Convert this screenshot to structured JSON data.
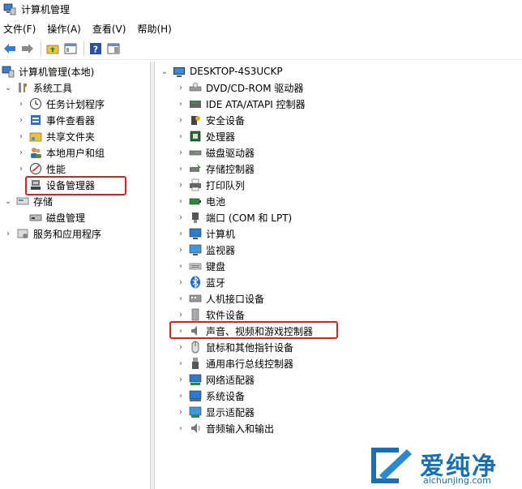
{
  "window": {
    "title": "计算机管理"
  },
  "menu": [
    "文件(F)",
    "操作(A)",
    "查看(V)",
    "帮助(H)"
  ],
  "left_tree": {
    "root": "计算机管理(本地)",
    "system_tools": "系统工具",
    "items": [
      "任务计划程序",
      "事件查看器",
      "共享文件夹",
      "本地用户和组",
      "性能",
      "设备管理器"
    ],
    "storage": "存储",
    "disk": "磁盘管理",
    "services": "服务和应用程序"
  },
  "right_tree": {
    "root": "DESKTOP-4S3UCKP",
    "items": [
      "DVD/CD-ROM 驱动器",
      "IDE ATA/ATAPI 控制器",
      "安全设备",
      "处理器",
      "磁盘驱动器",
      "存储控制器",
      "打印队列",
      "电池",
      "端口 (COM 和 LPT)",
      "计算机",
      "监视器",
      "键盘",
      "蓝牙",
      "人机接口设备",
      "软件设备",
      "声音、视频和游戏控制器",
      "鼠标和其他指针设备",
      "通用串行总线控制器",
      "网络适配器",
      "系统设备",
      "显示适配器",
      "音频输入和输出"
    ]
  },
  "watermark": {
    "text": "爱纯净",
    "url": "aichunjing.com"
  },
  "colors": {
    "highlight": "#e02020",
    "brand": "#1a6fb0"
  }
}
